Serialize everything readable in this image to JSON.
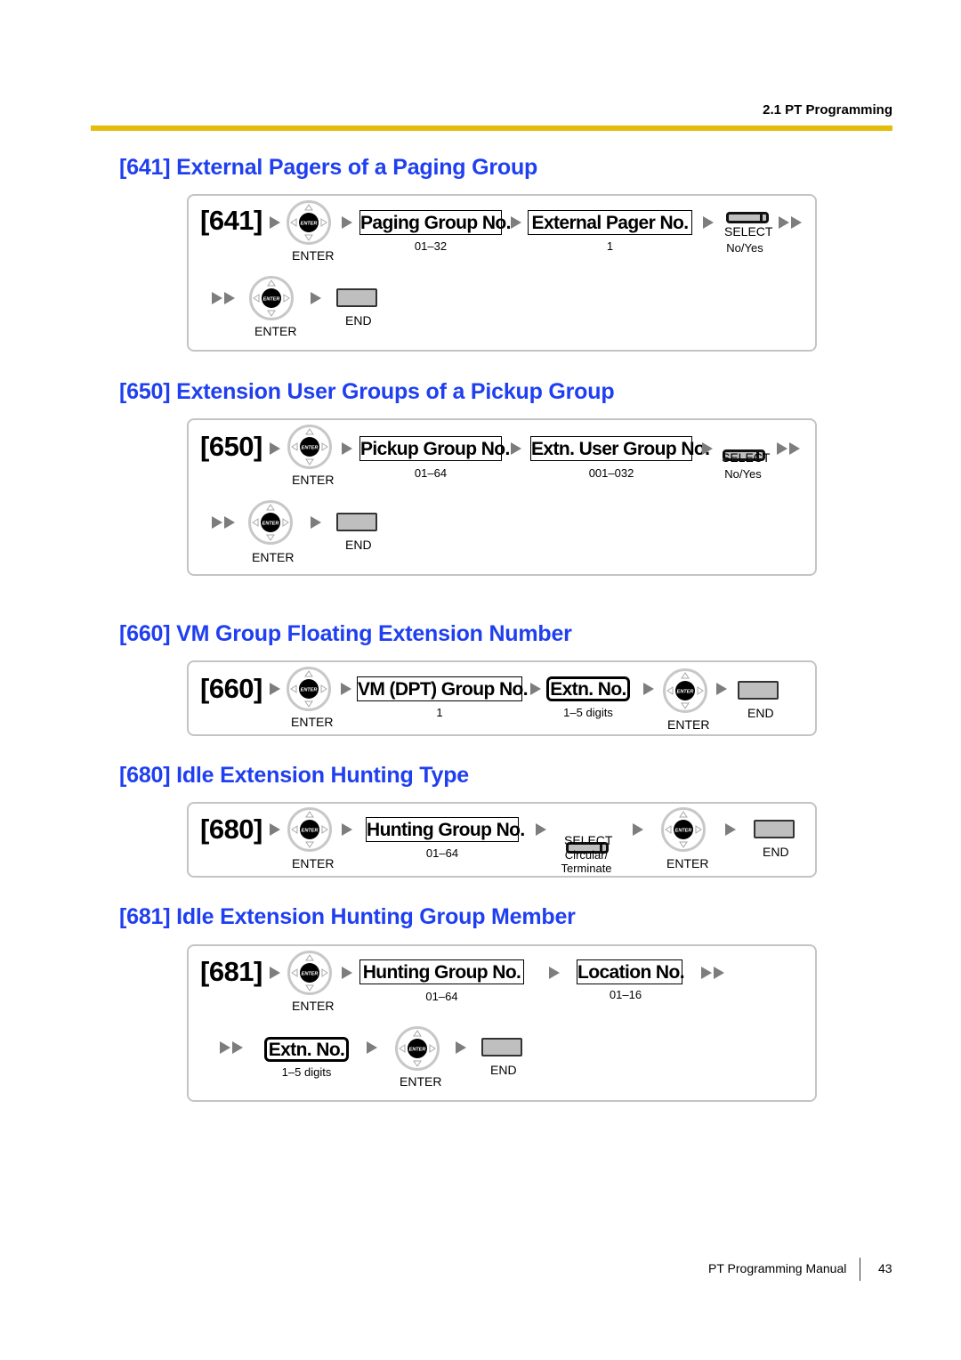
{
  "header": {
    "section": "2.1 PT Programming",
    "rule_color": "#e3bd0a"
  },
  "colors": {
    "section_title": "#1f3ff0",
    "panel_border": "#c4c4c4",
    "arrow": "#7d7d7d",
    "key_fill": "#bfbfbf"
  },
  "icons": {
    "enter": "enter-navigator-icon",
    "arrow": "play-arrow-icon",
    "double_arrow": "double-arrow-icon",
    "select": "select-key-icon",
    "end": "end-key-icon"
  },
  "common": {
    "enter_key_label": "ENTER",
    "enter_button_text": "ENTER",
    "select_label": "SELECT",
    "end_label": "END"
  },
  "sections": [
    {
      "title": "[641] External Pagers of a Paging Group",
      "code": "[641]",
      "fields": [
        {
          "label": "Paging Group No.",
          "range": "01–32"
        },
        {
          "label": "External Pager No.",
          "range": "1"
        }
      ],
      "select_options": "No/Yes"
    },
    {
      "title": "[650] Extension User Groups of a Pickup Group",
      "code": "[650]",
      "fields": [
        {
          "label": "Pickup Group No.",
          "range": "01–64"
        },
        {
          "label": "Extn. User Group No.",
          "range": "001–032"
        }
      ],
      "select_options": "No/Yes"
    },
    {
      "title": "[660] VM Group Floating Extension Number",
      "code": "[660]",
      "fields": [
        {
          "label": "VM (DPT) Group No.",
          "range": "1"
        },
        {
          "label": "Extn. No.",
          "range": "1–5 digits"
        }
      ]
    },
    {
      "title": "[680] Idle Extension Hunting Type",
      "code": "[680]",
      "fields": [
        {
          "label": "Hunting Group No.",
          "range": "01–64"
        }
      ],
      "select_options_line1": "Circular/",
      "select_options_line2": "Terminate"
    },
    {
      "title": "[681] Idle Extension Hunting Group Member",
      "code": "[681]",
      "fields": [
        {
          "label": "Hunting Group No.",
          "range": "01–64"
        },
        {
          "label": "Location No.",
          "range": "01–16"
        },
        {
          "label": "Extn. No.",
          "range": "1–5 digits"
        }
      ]
    }
  ],
  "footer": {
    "manual_title": "PT Programming Manual",
    "page_number": "43"
  }
}
